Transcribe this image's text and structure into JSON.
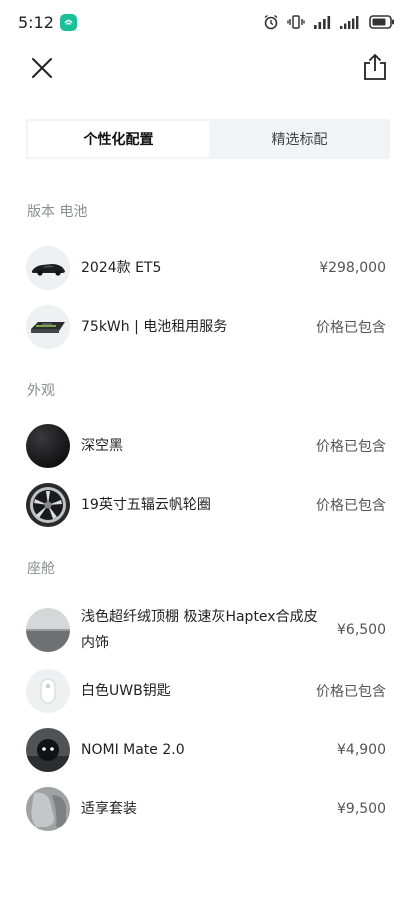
{
  "status_bar": {
    "time": "5:12"
  },
  "tabs": [
    {
      "label": "个性化配置",
      "active": true
    },
    {
      "label": "精选标配",
      "active": false
    }
  ],
  "sections": {
    "version": {
      "title": "版本 电池",
      "items": [
        {
          "name": "2024款 ET5",
          "price": "¥298,000",
          "thumb": "car-image"
        },
        {
          "name": "75kWh | 电池租用服务",
          "price": "价格已包含",
          "thumb": "battery-pack-image"
        }
      ]
    },
    "exterior": {
      "title": "外观",
      "items": [
        {
          "name": "深空黑",
          "price": "价格已包含",
          "thumb": "black-paint-swatch"
        },
        {
          "name": "19英寸五辐云帆轮圈",
          "price": "价格已包含",
          "thumb": "wheel-rim-image"
        }
      ]
    },
    "cabin": {
      "title": "座舱",
      "items": [
        {
          "name": "浅色超纤绒顶棚 极速灰Haptex合成皮内饰",
          "price": "¥6,500",
          "thumb": "interior-swatch"
        },
        {
          "name": "白色UWB钥匙",
          "price": "价格已包含",
          "thumb": "uwb-key-image"
        },
        {
          "name": "NOMI Mate 2.0",
          "price": "¥4,900",
          "thumb": "nomi-mate-image"
        },
        {
          "name": "适享套装",
          "price": "¥9,500",
          "thumb": "seat-package-image"
        }
      ]
    }
  },
  "colors": {
    "section_title": "#8a8d91",
    "tab_background": "#f2f3f4",
    "status_app_icon": "#1bbf9a"
  }
}
